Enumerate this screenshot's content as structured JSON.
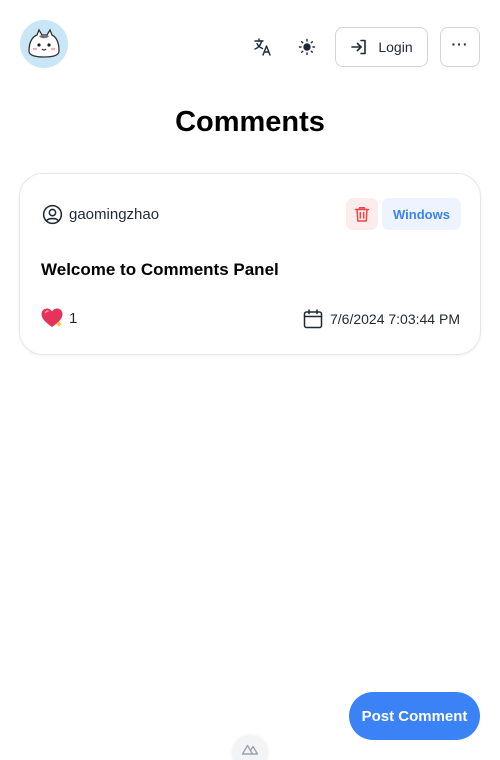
{
  "header": {
    "login_label": "Login",
    "more_label": "···"
  },
  "page": {
    "title": "Comments"
  },
  "comment": {
    "username": "gaomingzhao",
    "os_badge": "Windows",
    "text": "Welcome to Comments Panel",
    "like_count": "1",
    "date": "7/6/2024 7:03:44 PM"
  },
  "actions": {
    "post_label": "Post Comment"
  },
  "colors": {
    "accent": "#3b82f6",
    "delete_bg": "#fdecec",
    "delete_icon": "#ef4444",
    "badge_bg": "#eef4ff",
    "avatar_bg": "#c9e6f7"
  },
  "icons": [
    "cat-avatar",
    "translate-icon",
    "sun-icon",
    "login-icon",
    "more-icon",
    "user-circle-icon",
    "trash-icon",
    "heart-icon",
    "calendar-icon",
    "nuxt-icon"
  ]
}
